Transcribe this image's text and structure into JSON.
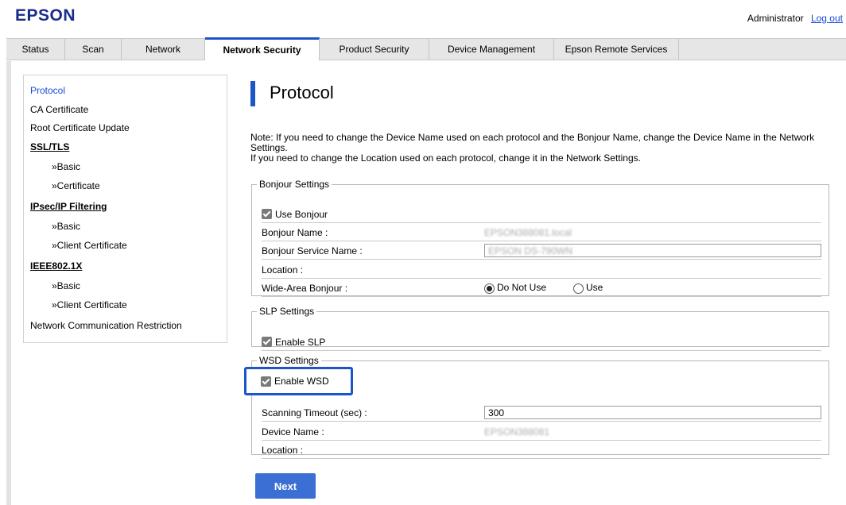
{
  "header": {
    "brand": "EPSON",
    "user": "Administrator",
    "logout": "Log out"
  },
  "tabs": [
    {
      "label": "Status"
    },
    {
      "label": "Scan"
    },
    {
      "label": "Network"
    },
    {
      "label": "Network Security",
      "active": true
    },
    {
      "label": "Product Security"
    },
    {
      "label": "Device Management"
    },
    {
      "label": "Epson Remote Services"
    }
  ],
  "sidebar": {
    "items": [
      "Protocol",
      "CA Certificate",
      "Root Certificate Update",
      "SSL/TLS",
      "»Basic",
      "»Certificate",
      "IPsec/IP Filtering",
      "»Basic",
      "»Client Certificate",
      "IEEE802.1X",
      "»Basic",
      "»Client Certificate",
      "Network Communication Restriction"
    ]
  },
  "page": {
    "title": "Protocol",
    "note1": "Note: If you need to change the Device Name used on each protocol and the Bonjour Name, change the Device Name in the Network Settings.",
    "note2": "If you need to change the Location used on each protocol, change it in the Network Settings."
  },
  "bonjour": {
    "legend": "Bonjour Settings",
    "use_label": "Use Bonjour",
    "name_label": "Bonjour Name :",
    "name_value": "EPSON388081.local",
    "service_label": "Bonjour Service Name :",
    "service_value": "EPSON DS-790WN",
    "location_label": "Location :",
    "wide_label": "Wide-Area Bonjour :",
    "opt_off": "Do Not Use",
    "opt_on": "Use"
  },
  "slp": {
    "legend": "SLP Settings",
    "enable_label": "Enable SLP"
  },
  "wsd": {
    "legend": "WSD Settings",
    "enable_label": "Enable WSD",
    "timeout_label": "Scanning Timeout (sec) :",
    "timeout_value": "300",
    "device_label": "Device Name :",
    "device_value": "EPSON388081",
    "location_label": "Location :"
  },
  "actions": {
    "next": "Next"
  },
  "colors": {
    "accent": "#1a56c8",
    "button": "#3b6fd4",
    "brand": "#1a2d8c"
  }
}
